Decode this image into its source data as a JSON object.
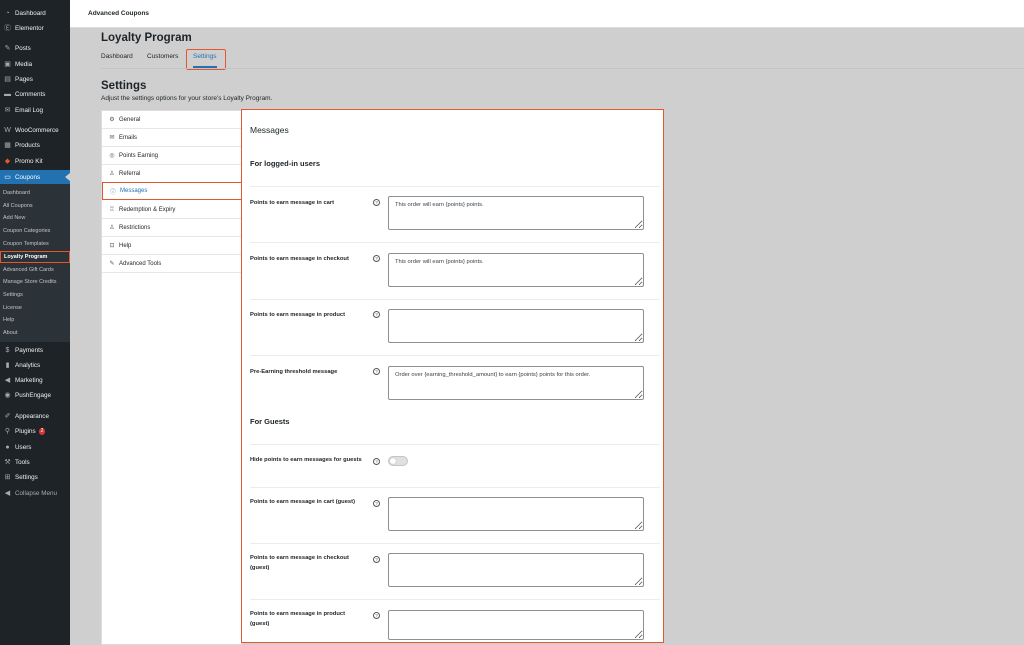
{
  "sidebar": {
    "menu": [
      {
        "label": "Dashboard",
        "icon": "dashboard-icon",
        "glyph": "◔"
      },
      {
        "label": "Elementor",
        "icon": "elementor-icon",
        "glyph": "Ⓔ"
      },
      {
        "label": "Posts",
        "icon": "pin-icon",
        "glyph": "✎"
      },
      {
        "label": "Media",
        "icon": "media-icon",
        "glyph": "▣"
      },
      {
        "label": "Pages",
        "icon": "pages-icon",
        "glyph": "▤"
      },
      {
        "label": "Comments",
        "icon": "comment-icon",
        "glyph": "▬"
      },
      {
        "label": "Email Log",
        "icon": "email-icon",
        "glyph": "✉"
      },
      {
        "label": "WooCommerce",
        "icon": "woocommerce-icon",
        "glyph": "W"
      },
      {
        "label": "Products",
        "icon": "products-icon",
        "glyph": "▦"
      },
      {
        "label": "Promo Kit",
        "icon": "promo-kit-icon",
        "glyph": "◆"
      },
      {
        "label": "Coupons",
        "icon": "coupon-icon",
        "glyph": "▭"
      }
    ],
    "submenu": [
      "Dashboard",
      "All Coupons",
      "Add New",
      "Coupon Categories",
      "Coupon Templates",
      "Loyalty Program",
      "Advanced Gift Cards",
      "Manage Store Credits",
      "Settings",
      "License",
      "Help",
      "About"
    ],
    "menu_bottom": [
      {
        "label": "Payments",
        "icon": "payments-icon",
        "glyph": "$"
      },
      {
        "label": "Analytics",
        "icon": "analytics-icon",
        "glyph": "▮"
      },
      {
        "label": "Marketing",
        "icon": "megaphone-icon",
        "glyph": "◀"
      },
      {
        "label": "PushEngage",
        "icon": "pushengage-icon",
        "glyph": "◉"
      },
      {
        "label": "Appearance",
        "icon": "brush-icon",
        "glyph": "✐"
      },
      {
        "label": "Plugins",
        "icon": "plugin-icon",
        "glyph": "⚲",
        "badge": "2"
      },
      {
        "label": "Users",
        "icon": "users-icon",
        "glyph": "●"
      },
      {
        "label": "Tools",
        "icon": "wrench-icon",
        "glyph": "⚒"
      },
      {
        "label": "Settings",
        "icon": "settings-icon",
        "glyph": "⊞"
      },
      {
        "label": "Collapse Menu",
        "icon": "collapse-icon",
        "glyph": "◀"
      }
    ]
  },
  "topbar": {
    "title": "Advanced Coupons"
  },
  "page": {
    "title": "Loyalty Program",
    "tabs": [
      "Dashboard",
      "Customers",
      "Settings"
    ],
    "settings_heading": "Settings",
    "settings_desc": "Adjust the settings options for your store's Loyalty Program."
  },
  "settings_nav": [
    {
      "label": "General",
      "icon": "gear-icon",
      "glyph": "⚙"
    },
    {
      "label": "Emails",
      "icon": "envelope-icon",
      "glyph": "✉"
    },
    {
      "label": "Points Earning",
      "icon": "coin-icon",
      "glyph": "◎"
    },
    {
      "label": "Referral",
      "icon": "user-icon",
      "glyph": "♙"
    },
    {
      "label": "Messages",
      "icon": "info-icon",
      "glyph": "ⓘ"
    },
    {
      "label": "Redemption & Expiry",
      "icon": "trophy-icon",
      "glyph": "♖"
    },
    {
      "label": "Restrictions",
      "icon": "user-lock-icon",
      "glyph": "♙"
    },
    {
      "label": "Help",
      "icon": "help-icon",
      "glyph": "⊡"
    },
    {
      "label": "Advanced Tools",
      "icon": "tools-icon",
      "glyph": "✎"
    }
  ],
  "panel": {
    "title": "Messages",
    "section_logged_in": "For logged-in users",
    "section_guests": "For Guests",
    "fields": [
      {
        "label": "Points to earn message in cart",
        "value": "This order will earn {points} points."
      },
      {
        "label": "Points to earn message in checkout",
        "value": "This order will earn {points} points."
      },
      {
        "label": "Points to earn message in product",
        "value": ""
      },
      {
        "label": "Pre-Earning threshold message",
        "value": "Order over {earning_threshold_amount} to earn {points} points for this order."
      }
    ],
    "toggle": {
      "label": "Hide points to earn messages for guests",
      "enabled": false
    },
    "guest_fields": [
      {
        "label": "Points to earn message in cart (guest)",
        "value": ""
      },
      {
        "label": "Points to earn message in checkout (guest)",
        "value": ""
      },
      {
        "label": "Points to earn message in product (guest)",
        "value": ""
      }
    ]
  },
  "colors": {
    "accent": "#2271b1",
    "highlight": "#e4572e",
    "sidebar": "#1d2327"
  }
}
